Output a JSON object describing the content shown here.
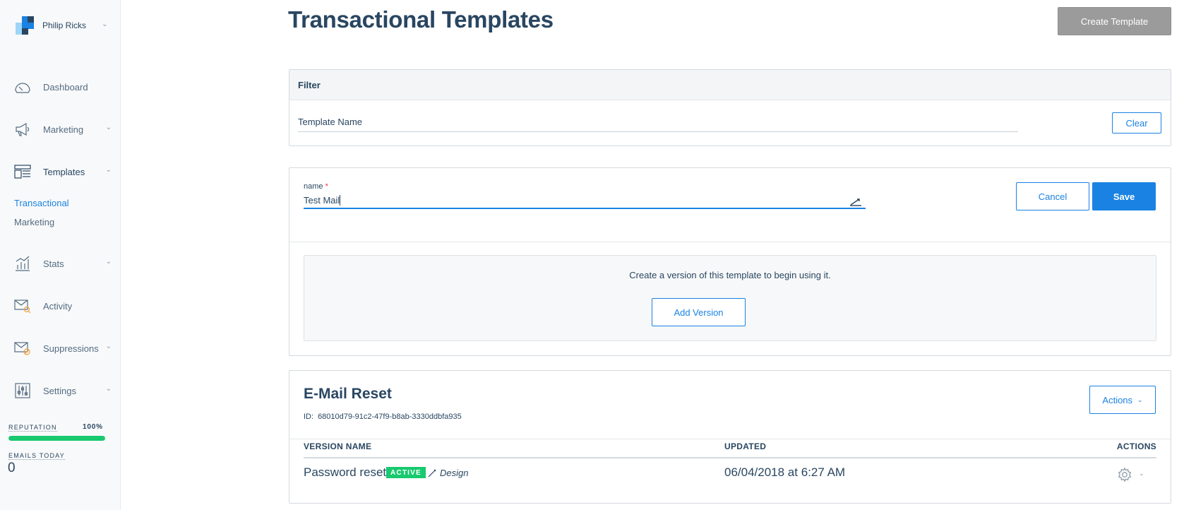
{
  "account": {
    "name": "Philip Ricks"
  },
  "sidebar": {
    "items": [
      {
        "label": "Dashboard"
      },
      {
        "label": "Marketing"
      },
      {
        "label": "Templates"
      },
      {
        "label": "Stats"
      },
      {
        "label": "Activity"
      },
      {
        "label": "Suppressions"
      },
      {
        "label": "Settings"
      }
    ],
    "templates_sub": [
      {
        "label": "Transactional"
      },
      {
        "label": "Marketing"
      }
    ],
    "reputation": {
      "label": "REPUTATION",
      "value": "100%",
      "fraction": 1.0
    },
    "emails_today": {
      "label": "EMAILS TODAY",
      "value": "0"
    }
  },
  "page": {
    "title": "Transactional Templates",
    "create_button": "Create Template"
  },
  "filter": {
    "heading": "Filter",
    "placeholder": "Template Name",
    "clear_button": "Clear"
  },
  "edit": {
    "name_label": "name",
    "required_mark": "*",
    "name_value": "Test Mail",
    "cancel_button": "Cancel",
    "save_button": "Save",
    "empty_text": "Create a version of this template to begin using it.",
    "add_version_button": "Add Version"
  },
  "template": {
    "title": "E-Mail Reset",
    "id_label": "ID:",
    "id_value": "68010d79-91c2-47f9-b8ab-3330ddbfa935",
    "actions_button": "Actions",
    "columns": {
      "version_name": "VERSION NAME",
      "updated": "UPDATED",
      "actions": "ACTIONS"
    },
    "versions": [
      {
        "name": "Password reset",
        "badge": "ACTIVE",
        "design_label": "Design",
        "updated": "06/04/2018 at 6:27 AM"
      }
    ]
  },
  "colors": {
    "accent": "#1a82e2",
    "text": "#294661",
    "success": "#18c96e",
    "create_button_bg": "#9b9b9b"
  }
}
